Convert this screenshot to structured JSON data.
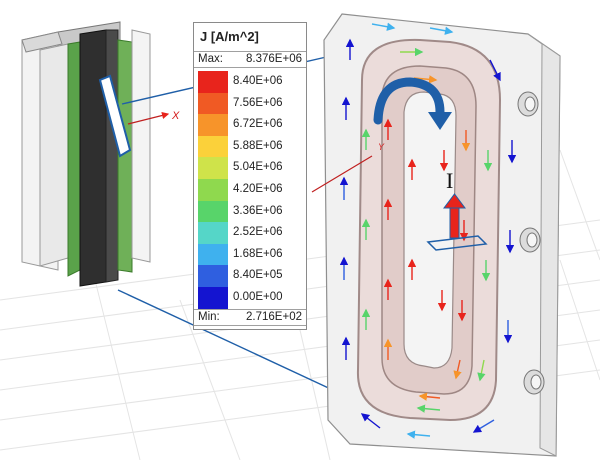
{
  "legend": {
    "title": "J [A/m^2]",
    "max_label": "Max:",
    "max_value": "8.376E+06",
    "min_label": "Min:",
    "min_value": "2.716E+02",
    "levels": [
      {
        "label": "8.40E+06",
        "color": "#e8241c"
      },
      {
        "label": "7.56E+06",
        "color": "#f05a24"
      },
      {
        "label": "6.72E+06",
        "color": "#f7942a"
      },
      {
        "label": "5.88E+06",
        "color": "#fbd13a"
      },
      {
        "label": "5.04E+06",
        "color": "#cfe34a"
      },
      {
        "label": "4.20E+06",
        "color": "#8fd94e"
      },
      {
        "label": "3.36E+06",
        "color": "#58d46a"
      },
      {
        "label": "2.52E+06",
        "color": "#55d6c8"
      },
      {
        "label": "1.68E+06",
        "color": "#3fb1ee"
      },
      {
        "label": "8.40E+05",
        "color": "#2f5fe0"
      },
      {
        "label": "0.00E+00",
        "color": "#1414d0"
      }
    ]
  },
  "axes": {
    "x_label": "X",
    "y_label": "Y"
  },
  "annotation": {
    "current_symbol": "I"
  },
  "colors": {
    "accent_blue": "#1f5fa8",
    "arrow_red": "#e8241c",
    "grid": "#e2e2e2"
  }
}
